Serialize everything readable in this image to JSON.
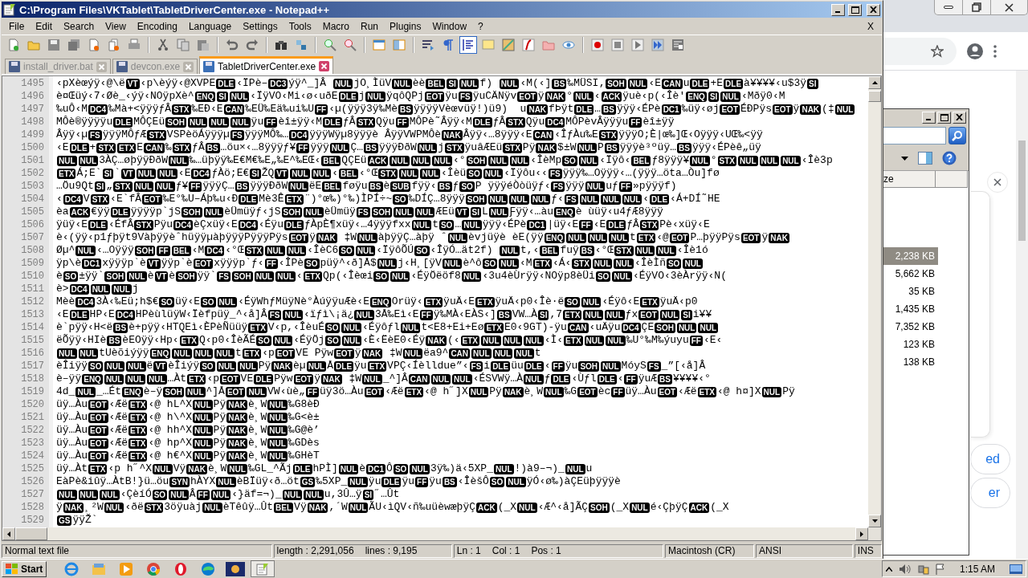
{
  "window": {
    "title": "C:\\Program Files\\VKTablet\\TabletDriverCenter.exe - Notepad++",
    "close_doc": "X"
  },
  "menu": [
    "File",
    "Edit",
    "Search",
    "View",
    "Encoding",
    "Language",
    "Settings",
    "Tools",
    "Macro",
    "Run",
    "Plugins",
    "Window",
    "?"
  ],
  "toolbar": [
    {
      "kind": "new",
      "pressed": false
    },
    {
      "kind": "open",
      "pressed": false
    },
    {
      "kind": "save",
      "pressed": false
    },
    {
      "kind": "saveall",
      "pressed": false
    },
    {
      "kind": "close",
      "pressed": false
    },
    {
      "kind": "closeall",
      "pressed": false
    },
    {
      "kind": "print",
      "pressed": false
    },
    {
      "kind": "sep"
    },
    {
      "kind": "cut",
      "pressed": false
    },
    {
      "kind": "copy",
      "pressed": false
    },
    {
      "kind": "paste",
      "pressed": false
    },
    {
      "kind": "sep"
    },
    {
      "kind": "undo",
      "pressed": false
    },
    {
      "kind": "redo",
      "pressed": false
    },
    {
      "kind": "sep"
    },
    {
      "kind": "find",
      "pressed": false
    },
    {
      "kind": "replace",
      "pressed": false
    },
    {
      "kind": "sep"
    },
    {
      "kind": "zoomin",
      "pressed": false
    },
    {
      "kind": "zoomout",
      "pressed": false
    },
    {
      "kind": "sep"
    },
    {
      "kind": "syncv",
      "pressed": false
    },
    {
      "kind": "synch",
      "pressed": false
    },
    {
      "kind": "sep"
    },
    {
      "kind": "wrap",
      "pressed": false
    },
    {
      "kind": "pilcrow",
      "pressed": false
    },
    {
      "kind": "indent",
      "pressed": true
    },
    {
      "kind": "note",
      "pressed": false
    },
    {
      "kind": "map",
      "pressed": false
    },
    {
      "kind": "func",
      "pressed": false
    },
    {
      "kind": "folder",
      "pressed": false
    },
    {
      "kind": "eye",
      "pressed": false
    },
    {
      "kind": "sep"
    },
    {
      "kind": "record",
      "pressed": false
    },
    {
      "kind": "stop",
      "pressed": false
    },
    {
      "kind": "play",
      "pressed": false
    },
    {
      "kind": "playmulti",
      "pressed": false
    },
    {
      "kind": "savemacro",
      "pressed": false
    }
  ],
  "tabs": [
    {
      "label": "install_driver.bat",
      "selected": false
    },
    {
      "label": "devcon.exe",
      "selected": false
    },
    {
      "label": "TabletDriverCenter.exe",
      "selected": true
    }
  ],
  "editor": {
    "lines": [
      {
        "number": "1495",
        "segments": [
          "‹pXèœýÿ‹@\\ë",
          {
            "control": "VT"
          },
          "‹p\\èýÿ‹@XVPE",
          {
            "control": "DLE"
          },
          "‹ÏPè–",
          {
            "control": "DC3"
          },
          "ýÿ^_]Â ",
          {
            "control": "NUL"
          },
          "jO¸ÌüV",
          {
            "control": "NUL"
          },
          "èè",
          {
            "control": "BEL"
          },
          {
            "control": "SI"
          },
          {
            "control": "NUL"
          },
          "f) ",
          {
            "control": "NUL"
          },
          "‹M(‹]",
          {
            "control": "BS"
          },
          "‰MÜSI‚",
          {
            "control": "SOH"
          },
          {
            "control": "NUL"
          },
          "‹E",
          {
            "control": "CAN"
          },
          "u",
          {
            "control": "DLE"
          },
          "+E",
          {
            "control": "DLE"
          },
          "à¥¥¥¥‹u$3ÿ",
          {
            "control": "SI"
          }
        ]
      },
      {
        "number": "1496",
        "segments": [
          "è¤Œüý‹7‹Øè_‹ýÿ‹NOÿpXè^",
          {
            "control": "ENQ"
          },
          {
            "control": "SI"
          },
          {
            "control": "NUL"
          },
          "‹ÏÿVO‹Mi‹ø‹uðE",
          {
            "control": "DLE"
          },
          "j",
          {
            "control": "NUL"
          },
          "ÿqôQPj",
          {
            "control": "EOT"
          },
          "ÿu",
          {
            "control": "FS"
          },
          "ÿuCÄNÿv",
          {
            "control": "EOT"
          },
          "ÿ",
          {
            "control": "NAK"
          },
          "°",
          {
            "control": "NUL"
          },
          "‹",
          {
            "control": "ACK"
          },
          "ÿuè‹p(‹Îè'",
          {
            "control": "ENQ"
          },
          {
            "control": "SI"
          },
          {
            "control": "NUL"
          },
          "‹Mðÿ0‹M"
        ]
      },
      {
        "number": "1497",
        "segments": [
          "‰uÔ‹M",
          {
            "control": "DC4"
          },
          "‰Mà+<ÿÿÿƒÂ",
          {
            "control": "STX"
          },
          "‰EÐ‹E",
          {
            "control": "CAN"
          },
          "‰EÜ‰Eä‰ui‰U",
          {
            "control": "FF"
          },
          "‹µ(ÿÿÿ3ÿ‰Mè",
          {
            "control": "BS"
          },
          "ÿÿÿÿVèœvüÿ!)ü9)  u",
          {
            "control": "NAK"
          },
          "fÞÿt",
          {
            "control": "DLE"
          },
          "…",
          {
            "control": "BS"
          },
          "ÿÿÿ‹ÉPè",
          {
            "control": "DC1"
          },
          "‰üÿ‹øj",
          {
            "control": "EOT"
          },
          "ÉÐPÿs",
          {
            "control": "EOT"
          },
          "ÿ",
          {
            "control": "NAK"
          },
          "(‡",
          {
            "control": "NUL"
          }
        ]
      },
      {
        "number": "1498",
        "segments": [
          "MÔè®ÿÿÿÿu",
          {
            "control": "DLE"
          },
          "MÔÇEü",
          {
            "control": "SOH"
          },
          {
            "control": "NUL"
          },
          {
            "control": "NUL"
          },
          {
            "control": "NUL"
          },
          "ÿu",
          {
            "control": "FF"
          },
          "èî±ÿÿ‹M",
          {
            "control": "DLE"
          },
          "ƒÂ",
          {
            "control": "STX"
          },
          "Qÿu",
          {
            "control": "FF"
          },
          "MÔPè˜Âÿÿ‹M",
          {
            "control": "DLE"
          },
          "ƒÂ",
          {
            "control": "STX"
          },
          "Qÿu",
          {
            "control": "DC4"
          },
          "MÔPèvÂÿÿÿu",
          {
            "control": "FF"
          },
          "èî±ÿÿ"
        ]
      },
      {
        "number": "1499",
        "segments": [
          "Âÿÿ‹µ",
          {
            "control": "FS"
          },
          "ÿÿÿMÔƒÆ",
          {
            "control": "STX"
          },
          "VSPèöÁÿÿÿµ",
          {
            "control": "FS"
          },
          "ÿÿÿMÔ‰…",
          {
            "control": "DC4"
          },
          "ÿÿÿWÿµ8ÿÿÿè ÂÿÿVWPMÔè",
          {
            "control": "NAK"
          },
          "Âÿÿ‹…8ÿÿÿ‹E",
          {
            "control": "CAN"
          },
          "‹ÎƒÀu‰E",
          {
            "control": "STX"
          },
          "ÿÿÿO;È|œ‰]Œ‹Oÿÿÿ‹UŒ‰<ÿÿ"
        ]
      },
      {
        "number": "1500",
        "segments": [
          "‹E",
          {
            "control": "DLE"
          },
          "+",
          {
            "control": "STX"
          },
          {
            "control": "ETX"
          },
          "E",
          {
            "control": "CAN"
          },
          "‰",
          {
            "control": "STX"
          },
          "ƒÂ",
          {
            "control": "BS"
          },
          "…öu×‹…8ÿÿÿƒ¥",
          {
            "control": "FF"
          },
          "ÿÿÿ",
          {
            "control": "NUL"
          },
          "Ç…",
          {
            "control": "BS"
          },
          "ÿÿÿÐðW",
          {
            "control": "NUL"
          },
          "j",
          {
            "control": "STX"
          },
          "ÿuâÆEü",
          {
            "control": "STX"
          },
          "Pÿ",
          {
            "control": "NAK"
          },
          "$±W",
          {
            "control": "NUL"
          },
          "P",
          {
            "control": "BS"
          },
          "ÿÿÿè³ºüÿ…",
          {
            "control": "BS"
          },
          "ÿÿÿ‹ÉPèê„üÿ"
        ]
      },
      {
        "number": "1501",
        "segments": [
          {
            "control": "NUL"
          },
          {
            "control": "NUL"
          },
          "3ÀÇ…øþÿÿÐðW",
          {
            "control": "NUL"
          },
          "‰…üþÿÿ‰E€M€‰E„‰E^‰EŒ‹",
          {
            "control": "BEL"
          },
          "QÇEü",
          {
            "control": "ACK"
          },
          {
            "control": "NUL"
          },
          {
            "control": "NUL"
          },
          {
            "control": "NUL"
          },
          "‹°",
          {
            "control": "SOH"
          },
          {
            "control": "NUL"
          },
          {
            "control": "NUL"
          },
          "‹ÎèMp",
          {
            "control": "SO"
          },
          {
            "control": "NUL"
          },
          "‹Ïÿô‹",
          {
            "control": "BEL"
          },
          "ƒ8ÿÿÿ¥",
          {
            "control": "NUL"
          },
          "°",
          {
            "control": "STX"
          },
          {
            "control": "NUL"
          },
          {
            "control": "NUL"
          },
          {
            "control": "NUL"
          },
          "‹Îè3p"
        ]
      },
      {
        "number": "1502",
        "segments": [
          {
            "control": "ETX"
          },
          "Á;E`",
          {
            "control": "SI"
          },
          "`",
          {
            "control": "VT"
          },
          {
            "control": "NUL"
          },
          {
            "control": "NUL"
          },
          "‹E",
          {
            "control": "DC4"
          },
          "ƒÀö;E€",
          {
            "control": "SI"
          },
          "ŽQ",
          {
            "control": "VT"
          },
          {
            "control": "NUL"
          },
          {
            "control": "NUL"
          },
          "‹",
          {
            "control": "BEL"
          },
          "‹°Œ",
          {
            "control": "STX"
          },
          {
            "control": "NUL"
          },
          {
            "control": "NUL"
          },
          "‹Îèü",
          {
            "control": "SO"
          },
          {
            "control": "NUL"
          },
          "‹Ïÿôu‹‹",
          {
            "control": "FS"
          },
          "ÿÿÿ‰…Oÿÿÿ‹…(ÿÿÿ…öta…Òu]fø"
        ]
      },
      {
        "number": "1503",
        "segments": [
          "…Öu9Qt",
          {
            "control": "SI"
          },
          "„",
          {
            "control": "STX"
          },
          {
            "control": "NUL"
          },
          {
            "control": "NUL"
          },
          "ƒ¥",
          {
            "control": "FF"
          },
          "ÿÿÿÇ…",
          {
            "control": "BS"
          },
          "ÿÿÿÐðW",
          {
            "control": "NUL"
          },
          "ëE",
          {
            "control": "BEL"
          },
          "føÿu",
          {
            "control": "BS"
          },
          "è",
          {
            "control": "SUB"
          },
          "fÿÿ‹",
          {
            "control": "BS"
          },
          "ƒ",
          {
            "control": "SO"
          },
          "P ÿÿÿéÒòüÿƒ‹",
          {
            "control": "FS"
          },
          "ÿÿÿ",
          {
            "control": "NUL"
          },
          "uƒ",
          {
            "control": "FF"
          },
          "»pÿÿÿf)"
        ]
      },
      {
        "number": "1504",
        "segments": [
          "‹",
          {
            "control": "DC4"
          },
          "V",
          {
            "control": "STX"
          },
          "‹E`fÂ",
          {
            "control": "EOT"
          },
          "‰E°‰U–Áþ‰u‹Ð",
          {
            "control": "DLE"
          },
          "Mè3Ê",
          {
            "control": "ETX"
          },
          "¨)°œ‰)°‰)ÌPÍ÷~",
          {
            "control": "SO"
          },
          "‰DÍÇ…8ÿÿÿ",
          {
            "control": "SOH"
          },
          {
            "control": "NUL"
          },
          {
            "control": "NUL"
          },
          {
            "control": "NUL"
          },
          "ƒ‹",
          {
            "control": "FS"
          },
          {
            "control": "NUL"
          },
          {
            "control": "NUL"
          },
          {
            "control": "NUL"
          },
          "‹",
          {
            "control": "DLE"
          },
          "‹Á+DÍ˜HE"
        ]
      },
      {
        "number": "1505",
        "segments": [
          "èa",
          {
            "control": "ACK"
          },
          "€ÿÿ",
          {
            "control": "DLE"
          },
          "ÿÿÿÿp`jS",
          {
            "control": "SOH"
          },
          {
            "control": "NUL"
          },
          "èÜmüÿƒ‹jS",
          {
            "control": "SOH"
          },
          {
            "control": "NUL"
          },
          "èÜmüÿ",
          {
            "control": "FS"
          },
          {
            "control": "SOH"
          },
          {
            "control": "NUL"
          },
          {
            "control": "NUL"
          },
          "ÆEü",
          {
            "control": "VT"
          },
          {
            "control": "SI"
          },
          "L",
          {
            "control": "NUL"
          },
          "Ƒÿÿ‹…àu",
          {
            "control": "ENQ"
          },
          "è ùüÿ‹u4ƒÆ8ÿÿÿ"
        ]
      },
      {
        "number": "1506",
        "segments": [
          "ÿüÿ‹E",
          {
            "control": "DLE"
          },
          "‹ÉfÂ",
          {
            "control": "STX"
          },
          "Pÿu",
          {
            "control": "DC4"
          },
          "èÇxüÿ‹E",
          {
            "control": "DC4"
          },
          "‹Éÿu",
          {
            "control": "DLE"
          },
          "ƒÀpÈ¶xüÿ‹…4ÿÿÿfxx",
          {
            "control": "NUL"
          },
          "t",
          {
            "control": "SO"
          },
          "…",
          {
            "control": "NUL"
          },
          "ÿÿÿ‹ÉPè",
          {
            "control": "DC1"
          },
          "|üÿ‹E",
          {
            "control": "FF"
          },
          "‹E",
          {
            "control": "DLE"
          },
          "ƒÂ",
          {
            "control": "STX"
          },
          "Pè‹xüÿ‹E"
        ]
      },
      {
        "number": "1507",
        "segments": [
          "è‹(ÿÿ‹p1ƒþÿt9VàþÿÿèˆhüÿÿµàþÿÿÿPÿÿÿPÿs",
          {
            "control": "EOT"
          },
          "ÿ",
          {
            "control": "NAK"
          },
          " ‡W",
          {
            "control": "NUL"
          },
          "àþÿÿÇ…àþÿ ˆ",
          {
            "control": "NUL"
          },
          "èvjüÿè èE(ÿÿ",
          {
            "control": "ENQ"
          },
          {
            "control": "NUL"
          },
          {
            "control": "NUL"
          },
          {
            "control": "NUL"
          },
          "t",
          {
            "control": "ETX"
          },
          "‹@",
          {
            "control": "EOT"
          },
          "P…þÿÿPÿs",
          {
            "control": "EOT"
          },
          "ÿ",
          {
            "control": "NAK"
          }
        ]
      },
      {
        "number": "1508",
        "segments": [
          "Øµ^",
          {
            "control": "NUL"
          },
          "‹…Oÿÿÿ",
          {
            "control": "SOH"
          },
          {
            "control": "FF"
          },
          {
            "control": "BEL"
          },
          "‹M",
          {
            "control": "DC4"
          },
          "‹°Œ",
          {
            "control": "STX"
          },
          {
            "control": "NUL"
          },
          {
            "control": "NUL"
          },
          "‹ÎèC6",
          {
            "control": "SO"
          },
          {
            "control": "NUL"
          },
          "‹ÏÿôÕÚ",
          {
            "control": "SO"
          },
          "‹ÎÿÓ…ät2f) ",
          {
            "control": "NUL"
          },
          "t,‹",
          {
            "control": "BEL"
          },
          "fuÿ",
          {
            "control": "BS"
          },
          "‹°Œ",
          {
            "control": "STX"
          },
          {
            "control": "NUL"
          },
          {
            "control": "NUL"
          },
          "‹Îè1ó"
        ]
      },
      {
        "number": "1509",
        "segments": [
          "ÿp\\è",
          {
            "control": "DC1"
          },
          "xÿÿÿp`è",
          {
            "control": "VT"
          },
          "ÿÿp`è",
          {
            "control": "EOT"
          },
          "xÿÿÿp`ƒ‹",
          {
            "control": "FF"
          },
          "‹ÎPè",
          {
            "control": "SO"
          },
          "püÿ^‹ð]Å$",
          {
            "control": "NUL"
          },
          "j‹H¸[ÿV",
          {
            "control": "NUL"
          },
          "è^ô",
          {
            "control": "SO"
          },
          {
            "control": "NUL"
          },
          "‹M",
          {
            "control": "ETX"
          },
          "‹Á‹",
          {
            "control": "STX"
          },
          {
            "control": "NUL"
          },
          {
            "control": "NUL"
          },
          "‹ÎèÌñ",
          {
            "control": "SO"
          },
          {
            "control": "NUL"
          }
        ]
      },
      {
        "number": "1510",
        "segments": [
          "è",
          {
            "control": "SO"
          },
          "±ÿÿ`",
          {
            "control": "SOH"
          },
          {
            "control": "NUL"
          },
          "è",
          {
            "control": "VT"
          },
          "è",
          {
            "control": "SOH"
          },
          "ÿÿ`",
          {
            "control": "FS"
          },
          {
            "control": "SOH"
          },
          {
            "control": "NUL"
          },
          {
            "control": "NUL"
          },
          "‹",
          {
            "control": "ETX"
          },
          "Qp(‹Îèœi",
          {
            "control": "SO"
          },
          {
            "control": "NUL"
          },
          "‹ÉÿÖëöf8",
          {
            "control": "NUL"
          },
          "‹3u4èÙrÿÿ‹NOÿp8èÜi",
          {
            "control": "SO"
          },
          {
            "control": "NUL"
          },
          "‹ÉÿVO‹3èÀrÿÿ‹N("
        ]
      },
      {
        "number": "1511",
        "segments": [
          "è>",
          {
            "control": "DC4"
          },
          {
            "control": "NUL"
          },
          {
            "control": "NUL"
          },
          "j"
        ]
      },
      {
        "number": "1512",
        "segments": [
          "Mèè",
          {
            "control": "DC4"
          },
          "3À‹‰Eü;h$€",
          {
            "control": "SO"
          },
          "üÿ‹E",
          {
            "control": "SO"
          },
          {
            "control": "NUL"
          },
          "‹ÉÿWhƒMüÿNè°ÀúÿÿuÆè‹E",
          {
            "control": "ENQ"
          },
          "Orüÿ‹",
          {
            "control": "ETX"
          },
          "ÿuÄ‹E",
          {
            "control": "ETX"
          },
          "ÿuÄ‹p0‹Îè·ë",
          {
            "control": "SO"
          },
          {
            "control": "NUL"
          },
          "‹Éÿô‹E",
          {
            "control": "ETX"
          },
          "ÿuÄ‹p0"
        ]
      },
      {
        "number": "1513",
        "segments": [
          "‹E",
          {
            "control": "DLE"
          },
          "HP‹E",
          {
            "control": "DC4"
          },
          "HPèùlüÿW‹Ïèfpüÿ_^‹å]Â",
          {
            "control": "FS"
          },
          {
            "control": "NUL"
          },
          "‹ïƒì\\¡ä¿",
          {
            "control": "NUL"
          },
          "3Å‰Eì‹E",
          {
            "control": "FF"
          },
          "ÿ‰MÀ‹EÀS‹]",
          {
            "control": "BS"
          },
          "VW…À",
          {
            "control": "SI"
          },
          ",7",
          {
            "control": "ETX"
          },
          {
            "control": "NUL"
          },
          {
            "control": "NUL"
          },
          "ƒx",
          {
            "control": "EOT"
          },
          {
            "control": "NUL"
          },
          {
            "control": "SI"
          },
          "i¥¥"
        ]
      },
      {
        "number": "1514",
        "segments": [
          "è`pÿÿ‹H<ë",
          {
            "control": "BS"
          },
          "è+pÿÿ‹HTQEì‹ÈPèÑüüÿ",
          {
            "control": "ETX"
          },
          "V‹p,‹ÎèuÉ",
          {
            "control": "SO"
          },
          {
            "control": "NUL"
          },
          "‹Éÿôƒl",
          {
            "control": "NUL"
          },
          "t<E8+Ei+Eø",
          {
            "control": "ETX"
          },
          "E0‹9GT)-ÿu",
          {
            "control": "CAN"
          },
          "‹uÄÿu",
          {
            "control": "DC4"
          },
          "ÇE",
          {
            "control": "SOH"
          },
          {
            "control": "NUL"
          },
          {
            "control": "NUL"
          }
        ]
      },
      {
        "number": "1515",
        "segments": [
          "ëÕÿÿ‹HIè",
          {
            "control": "BS"
          },
          "èEOÿÿ‹Hp‹",
          {
            "control": "ETX"
          },
          "Q‹p0‹ÎèÃÉ",
          {
            "control": "SO"
          },
          {
            "control": "NUL"
          },
          "‹ÉÿÖj",
          {
            "control": "SO"
          },
          {
            "control": "NUL"
          },
          "‹È‹ËèE0‹Éÿ",
          {
            "control": "NAK"
          },
          "(‹",
          {
            "control": "ETX"
          },
          {
            "control": "NUL"
          },
          {
            "control": "NUL"
          },
          {
            "control": "NUL"
          },
          "‹Ì‹",
          {
            "control": "ETX"
          },
          {
            "control": "NUL"
          },
          {
            "control": "NUL"
          },
          "‰U°‰M‰ýuyu",
          {
            "control": "FF"
          },
          "‹E‹"
        ]
      },
      {
        "number": "1516",
        "segments": [
          {
            "control": "NUL"
          },
          {
            "control": "NUL"
          },
          "tUèõiýÿÿ",
          {
            "control": "ENQ"
          },
          {
            "control": "NUL"
          },
          {
            "control": "NUL"
          },
          {
            "control": "NUL"
          },
          "t",
          {
            "control": "ETX"
          },
          "‹p",
          {
            "control": "EOT"
          },
          "VE Pÿw",
          {
            "control": "EOT"
          },
          "ÿ",
          {
            "control": "NAK"
          },
          " ‡W",
          {
            "control": "NUL"
          },
          "ëa9^",
          {
            "control": "CAN"
          },
          {
            "control": "NUL"
          },
          {
            "control": "NUL"
          },
          {
            "control": "NUL"
          },
          "t"
        ]
      },
      {
        "number": "1517",
        "segments": [
          "èÎiÿÿ",
          {
            "control": "SO"
          },
          {
            "control": "NUL"
          },
          {
            "control": "NUL"
          },
          "ë",
          {
            "control": "VT"
          },
          "èÎiýÿ",
          {
            "control": "SO"
          },
          {
            "control": "NUL"
          },
          {
            "control": "NUL"
          },
          "Pÿ",
          {
            "control": "NAK"
          },
          "èµ",
          {
            "control": "NUL"
          },
          "Å",
          {
            "control": "DLE"
          },
          "ÿu",
          {
            "control": "ETX"
          },
          "VPÇ‹Íèlldue”‹",
          {
            "control": "FS"
          },
          "i",
          {
            "control": "DLE"
          },
          "üu",
          {
            "control": "DLE"
          },
          "‹",
          {
            "control": "FF"
          },
          "ÿu",
          {
            "control": "SOH"
          },
          {
            "control": "NUL"
          },
          "MóyS",
          {
            "control": "FS"
          },
          "_”[‹å]Â"
        ]
      },
      {
        "number": "1518",
        "segments": [
          "è–ÿÿ",
          {
            "control": "ENQ"
          },
          {
            "control": "NUL"
          },
          {
            "control": "NUL"
          },
          {
            "control": "NUL"
          },
          "…Àt",
          {
            "control": "ETX"
          },
          "‹p",
          {
            "control": "EOT"
          },
          "VE",
          {
            "control": "DLE"
          },
          "Pÿw",
          {
            "control": "EOT"
          },
          "ÿ",
          {
            "control": "NAK"
          },
          " ‡W",
          {
            "control": "NUL"
          },
          "_^]Â",
          {
            "control": "CAN"
          },
          {
            "control": "NUL"
          },
          {
            "control": "NUL"
          },
          "‹ÉSVWÿ…À",
          {
            "control": "NUL"
          },
          "ƒ",
          {
            "control": "DLE"
          },
          "‹Ùƒl",
          {
            "control": "DLE"
          },
          "‹",
          {
            "control": "FF"
          },
          "ÿuÆ",
          {
            "control": "BS"
          },
          "¥¥¥¥‹°"
        ]
      },
      {
        "number": "1519",
        "segments": [
          "4d_",
          {
            "control": "NUL"
          },
          "_…Ét",
          {
            "control": "ENQ"
          },
          "è–ÿ",
          {
            "control": "SOH"
          },
          {
            "control": "NUL"
          },
          "^]Å",
          {
            "control": "EOT"
          },
          {
            "control": "NUL"
          },
          "VW‹ùè„",
          {
            "control": "FF"
          },
          "üÿ3ö…Àu",
          {
            "control": "EOT"
          },
          "‹Æë",
          {
            "control": "ETX"
          },
          "‹@ h˝]X",
          {
            "control": "NUL"
          },
          "Pÿ",
          {
            "control": "NAK"
          },
          "è¸W",
          {
            "control": "NUL"
          },
          "‰G",
          {
            "control": "EOT"
          },
          "èc",
          {
            "control": "FF"
          },
          "üÿ…Àu",
          {
            "control": "EOT"
          },
          "‹Æë",
          {
            "control": "ETX"
          },
          "‹@ h¤]X",
          {
            "control": "NUL"
          },
          "Pÿ"
        ]
      },
      {
        "number": "1520",
        "segments": [
          "üÿ…Àu",
          {
            "control": "EOT"
          },
          "‹Æë",
          {
            "control": "ETX"
          },
          "‹@ hL^X",
          {
            "control": "NUL"
          },
          "Pÿ",
          {
            "control": "NAK"
          },
          "è¸W",
          {
            "control": "NUL"
          },
          "‰G8èÐ"
        ]
      },
      {
        "number": "1521",
        "segments": [
          "üÿ…Àu",
          {
            "control": "EOT"
          },
          "‹Æë",
          {
            "control": "ETX"
          },
          "‹@ h\\^X",
          {
            "control": "NUL"
          },
          "Pÿ",
          {
            "control": "NAK"
          },
          "è¸W",
          {
            "control": "NUL"
          },
          "‰G<è±"
        ]
      },
      {
        "number": "1522",
        "segments": [
          "üÿ…Àu",
          {
            "control": "EOT"
          },
          "‹Æë",
          {
            "control": "ETX"
          },
          "‹@ hh^X",
          {
            "control": "NUL"
          },
          "Pÿ",
          {
            "control": "NAK"
          },
          "è¸W",
          {
            "control": "NUL"
          },
          "‰G@è’"
        ]
      },
      {
        "number": "1523",
        "segments": [
          "üÿ…Àu",
          {
            "control": "EOT"
          },
          "‹Æë",
          {
            "control": "ETX"
          },
          "‹@ hp^X",
          {
            "control": "NUL"
          },
          "Pÿ",
          {
            "control": "NAK"
          },
          "è¸W",
          {
            "control": "NUL"
          },
          "‰GDès"
        ]
      },
      {
        "number": "1524",
        "segments": [
          "üÿ…Àu",
          {
            "control": "EOT"
          },
          "‹Æë",
          {
            "control": "ETX"
          },
          "‹@ h€^X",
          {
            "control": "NUL"
          },
          "Pÿ",
          {
            "control": "NAK"
          },
          "è¸W",
          {
            "control": "NUL"
          },
          "‰GHèT"
        ]
      },
      {
        "number": "1525",
        "segments": [
          "üÿ…Àt",
          {
            "control": "ETX"
          },
          "‹p h˝^X",
          {
            "control": "NUL"
          },
          "Vÿ",
          {
            "control": "NAK"
          },
          "è¸W",
          {
            "control": "NUL"
          },
          "‰GL_^Ãj",
          {
            "control": "DLE"
          },
          "hPÌ]",
          {
            "control": "NUL"
          },
          "è",
          {
            "control": "DC1"
          },
          "Ô",
          {
            "control": "SO"
          },
          {
            "control": "NUL"
          },
          "3ÿ‰)ä‹5XP_",
          {
            "control": "NUL"
          },
          "!)à9–¬)_",
          {
            "control": "NUL"
          },
          "u"
        ]
      },
      {
        "number": "1526",
        "segments": [
          "EàPè&iûÿ…ÀtB!}ü…öu",
          {
            "control": "SYN"
          },
          "hÀYX",
          {
            "control": "NUL"
          },
          "èBÏüÿ‹ð…öt",
          {
            "control": "GS"
          },
          "‰5XP_",
          {
            "control": "NUL"
          },
          "ÿu",
          {
            "control": "DLE"
          },
          "ÿu",
          {
            "control": "FF"
          },
          "ÿu",
          {
            "control": "BS"
          },
          "‹ÎèšÔ",
          {
            "control": "SO"
          },
          {
            "control": "NUL"
          },
          "ÿÓ‹ø‰)àÇEüþÿÿÿè"
        ]
      },
      {
        "number": "1527",
        "segments": [
          {
            "control": "NUL"
          },
          {
            "control": "NUL"
          },
          {
            "control": "NUL"
          },
          "‹ÇèíÓ",
          {
            "control": "SO"
          },
          {
            "control": "NUL"
          },
          "Â",
          {
            "control": "FF"
          },
          {
            "control": "NUL"
          },
          "‹}äf=¬)_",
          {
            "control": "NUL"
          },
          {
            "control": "NUL"
          },
          "u,3Û…ÿ",
          {
            "control": "SI"
          },
          "˝…Ût"
        ]
      },
      {
        "number": "1528",
        "segments": [
          "ÿ",
          {
            "control": "NAK"
          },
          "¸²W",
          {
            "control": "NUL"
          },
          "‹ðë",
          {
            "control": "STX"
          },
          "3öÿuàj",
          {
            "control": "NUL"
          },
          "èTêûÿ…Ût",
          {
            "control": "BEL"
          },
          "Vÿ",
          {
            "control": "NAK"
          },
          ",´W",
          {
            "control": "NUL"
          },
          "ÃU‹ìQV‹ñ‰uüèwæþÿÇ",
          {
            "control": "ACK"
          },
          "(_X",
          {
            "control": "NUL"
          },
          "‹Æ^‹å]ÃÇ",
          {
            "control": "SOH"
          },
          "(_X",
          {
            "control": "NUL"
          },
          "é‹ÇþÿÇ",
          {
            "control": "ACK"
          },
          "(_X"
        ]
      },
      {
        "number": "1529",
        "segments": [
          {
            "control": "GS"
          },
          "ÿÿŽ`"
        ]
      }
    ]
  },
  "status_bar": {
    "file_type": "Normal text file",
    "length": "length : 2,291,056",
    "lines": "lines : 9,195",
    "ln": "Ln : 1",
    "col": "Col : 1",
    "pos": "Pos : 1",
    "eol": "Macintosh (CR)",
    "encoding": "ANSI",
    "mode": "INS"
  },
  "explorer": {
    "size_header": "ze",
    "sizes": [
      {
        "text": "2,238 KB",
        "selected": true
      },
      {
        "text": "5,662 KB",
        "selected": false
      },
      {
        "text": "35 KB",
        "selected": false
      },
      {
        "text": "1,435 KB",
        "selected": false
      },
      {
        "text": "7,352 KB",
        "selected": false
      },
      {
        "text": "123 KB",
        "selected": false
      },
      {
        "text": "138 KB",
        "selected": false
      }
    ]
  },
  "browser": {
    "links": [
      "ed",
      "er"
    ]
  },
  "taskbar": {
    "start": "Start",
    "clock": "1:15 AM"
  }
}
